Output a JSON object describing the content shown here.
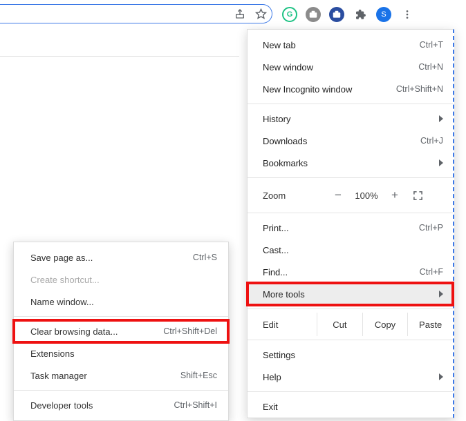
{
  "toolbar": {
    "share_icon": "share-icon",
    "star_icon": "star-icon"
  },
  "extensions": {
    "grammarly": "G",
    "profile_letter": "S"
  },
  "menu": {
    "new_tab": "New tab",
    "new_tab_sc": "Ctrl+T",
    "new_window": "New window",
    "new_window_sc": "Ctrl+N",
    "new_incognito": "New Incognito window",
    "new_incognito_sc": "Ctrl+Shift+N",
    "history": "History",
    "downloads": "Downloads",
    "downloads_sc": "Ctrl+J",
    "bookmarks": "Bookmarks",
    "zoom_label": "Zoom",
    "zoom_value": "100%",
    "zoom_minus": "−",
    "zoom_plus": "+",
    "print": "Print...",
    "print_sc": "Ctrl+P",
    "cast": "Cast...",
    "find": "Find...",
    "find_sc": "Ctrl+F",
    "more_tools": "More tools",
    "edit": "Edit",
    "cut": "Cut",
    "copy": "Copy",
    "paste": "Paste",
    "settings": "Settings",
    "help": "Help",
    "exit": "Exit"
  },
  "submenu": {
    "save_page": "Save page as...",
    "save_page_sc": "Ctrl+S",
    "create_shortcut": "Create shortcut...",
    "name_window": "Name window...",
    "clear_browsing": "Clear browsing data...",
    "clear_browsing_sc": "Ctrl+Shift+Del",
    "extensions": "Extensions",
    "task_manager": "Task manager",
    "task_manager_sc": "Shift+Esc",
    "dev_tools": "Developer tools",
    "dev_tools_sc": "Ctrl+Shift+I"
  }
}
